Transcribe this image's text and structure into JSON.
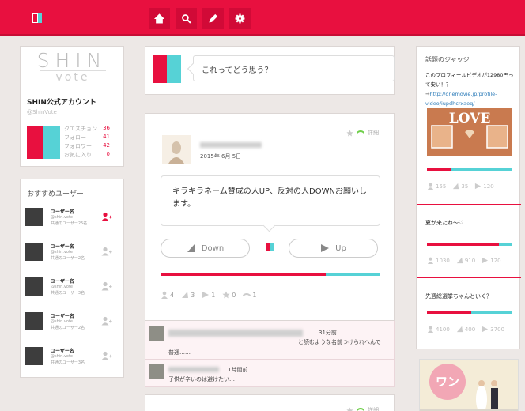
{
  "brand_colors": {
    "accent": "#e8103f",
    "teal": "#56d2d6"
  },
  "nav": {
    "icons": [
      "home-icon",
      "search-icon",
      "pencil-icon",
      "gear-icon"
    ]
  },
  "profile": {
    "brand_top": "SHIN",
    "brand_bottom": "vote",
    "name": "SHIN公式アカウント",
    "handle": "@ShinVote",
    "stats": [
      {
        "label": "クエスチョン",
        "value": "36"
      },
      {
        "label": "フォロー",
        "value": "41"
      },
      {
        "label": "フォロワー",
        "value": "42"
      },
      {
        "label": "お気に入り",
        "value": "0"
      }
    ]
  },
  "recommended": {
    "title": "おすすめユーザー",
    "users": [
      {
        "name": "ユーザー名",
        "handle": "@shin.vote",
        "common": "共通のユーザー25名",
        "active": true
      },
      {
        "name": "ユーザー名",
        "handle": "@shin.vote",
        "common": "共通のユーザー2名",
        "active": false
      },
      {
        "name": "ユーザー名",
        "handle": "@shin.vote",
        "common": "共通のユーザー3名",
        "active": false
      },
      {
        "name": "ユーザー名",
        "handle": "@shin.vote",
        "common": "共通のユーザー2名",
        "active": false
      },
      {
        "name": "ユーザー名",
        "handle": "@shin.vote",
        "common": "共通のユーザー3名",
        "active": false
      }
    ]
  },
  "compose": {
    "placeholder": "これってどう思う？"
  },
  "post": {
    "date": "2015年 6月 5日",
    "detail_label": "詳細",
    "question": "キラキラネーム賛成の人UP、反対の人DOWNお願いします。",
    "down_label": "Down",
    "up_label": "Up",
    "up_ratio": 0.75,
    "counts": {
      "users": "4",
      "down": "3",
      "up": "1",
      "stars": "0",
      "comments": "1"
    }
  },
  "comments": [
    {
      "time": "31分前",
      "text": "と読むような名前つけられへんで",
      "text2": "普通……"
    },
    {
      "time": "1時間前",
      "text": "子供が辛いのは避けたい…"
    }
  ],
  "next_post": {
    "detail_label": "詳細"
  },
  "trending": {
    "title": "話題のジャッジ",
    "items": [
      {
        "text": "このプロフィールビデオが12980円って安い！？→",
        "link": "http://onemovie.jp/profile-video/iupdhcrxaeq/",
        "image_text": "LOVE",
        "users": "155",
        "down": "35",
        "up": "120",
        "ratio": 0.28
      },
      {
        "text": "夏が来たね～♡",
        "users": "1030",
        "down": "910",
        "up": "120",
        "ratio": 0.84
      },
      {
        "text": "先週総選挙ちゃんといく？",
        "users": "4100",
        "down": "400",
        "up": "3700",
        "ratio": 0.52
      }
    ]
  },
  "ad": {
    "text": "ワン"
  }
}
